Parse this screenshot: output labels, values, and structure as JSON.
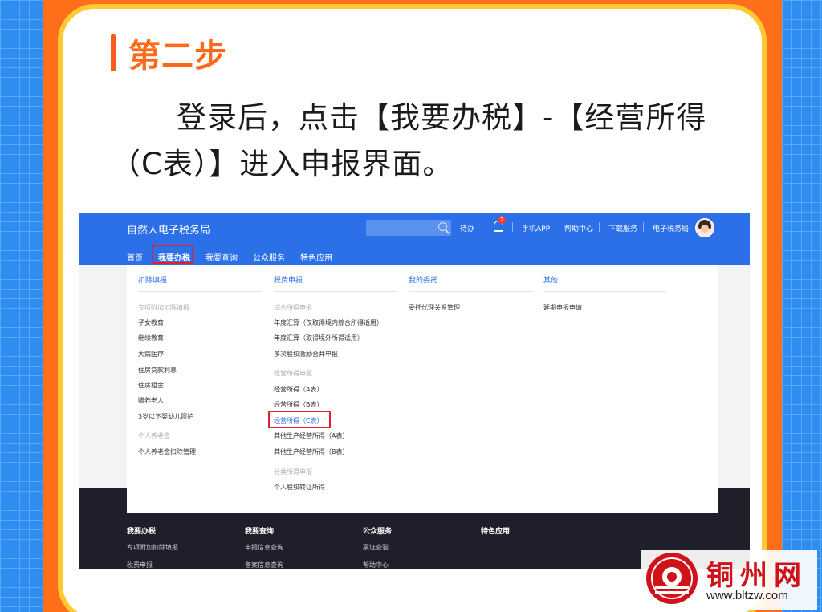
{
  "step": {
    "label": "第二步"
  },
  "instruction": "登录后，点击【我要办税】-【经营所得（C表）】进入申报界面。",
  "screenshot": {
    "site_title": "自然人电子税务局",
    "search": {
      "placeholder": ""
    },
    "top_nav": {
      "pending": "待办",
      "notification_count": "2",
      "mobile_app": "手机APP",
      "help_center": "帮助中心",
      "download": "下载服务",
      "etax_bureau": "电子税务局"
    },
    "main_nav": [
      {
        "label": "首页"
      },
      {
        "label": "我要办税"
      },
      {
        "label": "我要查询"
      },
      {
        "label": "公众服务"
      },
      {
        "label": "特色应用"
      }
    ],
    "menu": {
      "col1": {
        "head": "扣除填报",
        "group1": "专项附加扣除填报",
        "items1": [
          "子女教育",
          "继续教育",
          "大病医疗",
          "住房贷款利息",
          "住房租金",
          "赡养老人",
          "3岁以下婴幼儿照护"
        ],
        "group2": "个人养老金",
        "items2": [
          "个人养老金扣除管理"
        ]
      },
      "col2": {
        "head": "税费申报",
        "group1": "综合所得申报",
        "items1": [
          "年度汇算（仅取得境内综合所得适用）",
          "年度汇算（取得境外所得适用）",
          "多次股权激励合并申报"
        ],
        "group2": "经营所得申报",
        "items2": [
          "经营所得（A表）",
          "经营所得（B表）",
          "经营所得（C表）",
          "其他生产经营所得（A表）",
          "其他生产经营所得（B表）"
        ],
        "group3": "分类所得申报",
        "items3": [
          "个人股权转让所得"
        ]
      },
      "col3": {
        "head": "我的委托",
        "items": [
          "委托代理关系管理"
        ]
      },
      "col4": {
        "head": "其他",
        "items": [
          "延期申报申请"
        ]
      }
    },
    "footer": {
      "cols": [
        {
          "head": "我要办税",
          "items": [
            "专项附加扣除填报",
            "税费申报"
          ]
        },
        {
          "head": "我要查询",
          "items": [
            "申报信息查询",
            "备案信息查询"
          ]
        },
        {
          "head": "公众服务",
          "items": [
            "票证查验",
            "帮助中心"
          ]
        },
        {
          "head": "特色应用",
          "items": []
        }
      ]
    }
  },
  "watermark": {
    "name": "铜州网",
    "url": "www.bltzw.com"
  },
  "colors": {
    "brand_blue": "#2b6fe9",
    "highlight_red": "#e5202a",
    "step_orange": "#ff6a1a",
    "frame_yellow": "#ffc933"
  }
}
